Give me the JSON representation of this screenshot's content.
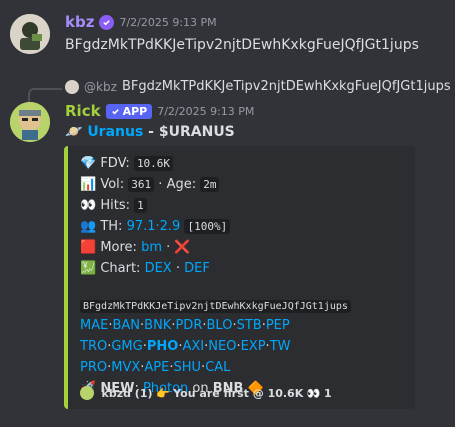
{
  "message1": {
    "author": "kbz",
    "timestamp": "7/2/2025 9:13 PM",
    "content": "BFgdzMkTPdKKJeTipv2njtDEwhKxkgFueJQfJGt1jups"
  },
  "reply": {
    "author": "@kbz",
    "content": "BFgdzMkTPdKKJeTipv2njtDEwhKxkgFueJQfJGt1jups"
  },
  "message2": {
    "author": "Rick",
    "badge": "APP",
    "timestamp": "7/2/2025 9:13 PM",
    "title_name": "Uranus",
    "title_sep": " - ",
    "title_ticker": "$URANUS",
    "embed": {
      "fdv_label": "FDV: ",
      "fdv_value": "10.6K",
      "vol_label": "Vol: ",
      "vol_value": "361",
      "age_label": " · Age: ",
      "age_value": "2m",
      "hits_label": "Hits: ",
      "hits_value": "1",
      "th_label": "TH: ",
      "th_value": "97.1·2.9",
      "th_pct": "[100%]",
      "more_label": "More: ",
      "more_link": "bm",
      "chart_label": "Chart: ",
      "chart_link1": "DEX",
      "chart_link2": "DEF",
      "contract": "BFgdzMkTPdKKJeTipv2njtDEwhKxkgFueJQfJGt1jups",
      "links_row1": [
        "MAE",
        "BAN",
        "BNK",
        "PDR",
        "BLO",
        "STB",
        "PEP"
      ],
      "links_row2": [
        "TRO",
        "GMG",
        "PHO",
        "AXI",
        "NEO",
        "EXP",
        "TW"
      ],
      "links_row3": [
        "PRO",
        "MVX",
        "APE",
        "SHU",
        "CAL"
      ],
      "new_label": "NEW",
      "new_link": "Photon",
      "new_on": " on ",
      "new_chain": "BNB",
      "footer_user": "kbzd (1)",
      "footer_text": "You are first @ 10.6K",
      "footer_count": "1"
    }
  },
  "colors": {
    "background": "#313338",
    "embed_bg": "#2b2d31",
    "accent": "#a3d13b",
    "link": "#00a8fc",
    "kbz_name": "#a78bfa"
  }
}
